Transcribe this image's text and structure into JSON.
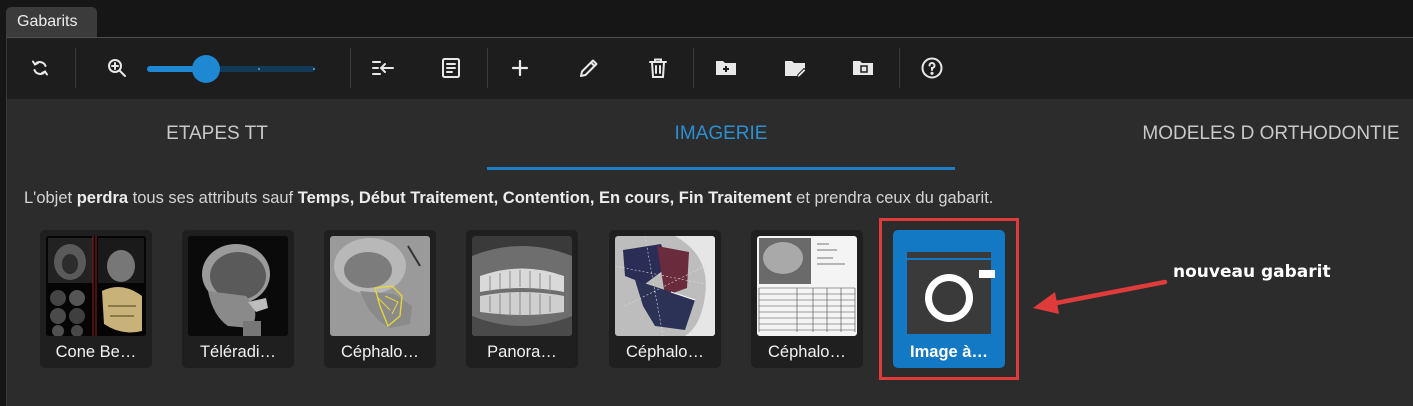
{
  "window": {
    "tab_title": "Gabarits"
  },
  "toolbar": {
    "buttons": [
      {
        "icon": "refresh-icon"
      },
      {
        "icon": "zoom-icon"
      },
      {
        "icon": "collapse-list-icon"
      },
      {
        "icon": "details-icon"
      },
      {
        "icon": "add-icon"
      },
      {
        "icon": "edit-icon"
      },
      {
        "icon": "delete-icon"
      },
      {
        "icon": "new-folder-icon"
      },
      {
        "icon": "rename-folder-icon"
      },
      {
        "icon": "folder-image-icon"
      },
      {
        "icon": "help-icon"
      }
    ],
    "zoom_level": 0.35
  },
  "tabs": [
    {
      "label": "ETAPES TT",
      "active": false
    },
    {
      "label": "IMAGERIE",
      "active": true
    },
    {
      "label": "MODELES D ORTHODONTIE",
      "active": false
    }
  ],
  "info": {
    "p1": "L'objet ",
    "b1": "perdra",
    "p2": " tous ses attributs sauf ",
    "b2": "Temps, Début Traitement, Contention, En cours, Fin Traitement",
    "p3": " et prendra ceux du gabarit."
  },
  "templates": [
    {
      "label": "Cone Be…"
    },
    {
      "label": "Téléradi…"
    },
    {
      "label": "Céphalo…"
    },
    {
      "label": "Panora…"
    },
    {
      "label": "Céphalo…"
    },
    {
      "label": "Céphalo…"
    },
    {
      "label": "Image à…",
      "selected": true
    }
  ],
  "annotation": {
    "text": "nouveau gabarit",
    "color": "#e03b3b"
  },
  "colors": {
    "accent": "#1e88d2",
    "background": "#2c2c2c",
    "toolbar": "#1d1d1d"
  }
}
